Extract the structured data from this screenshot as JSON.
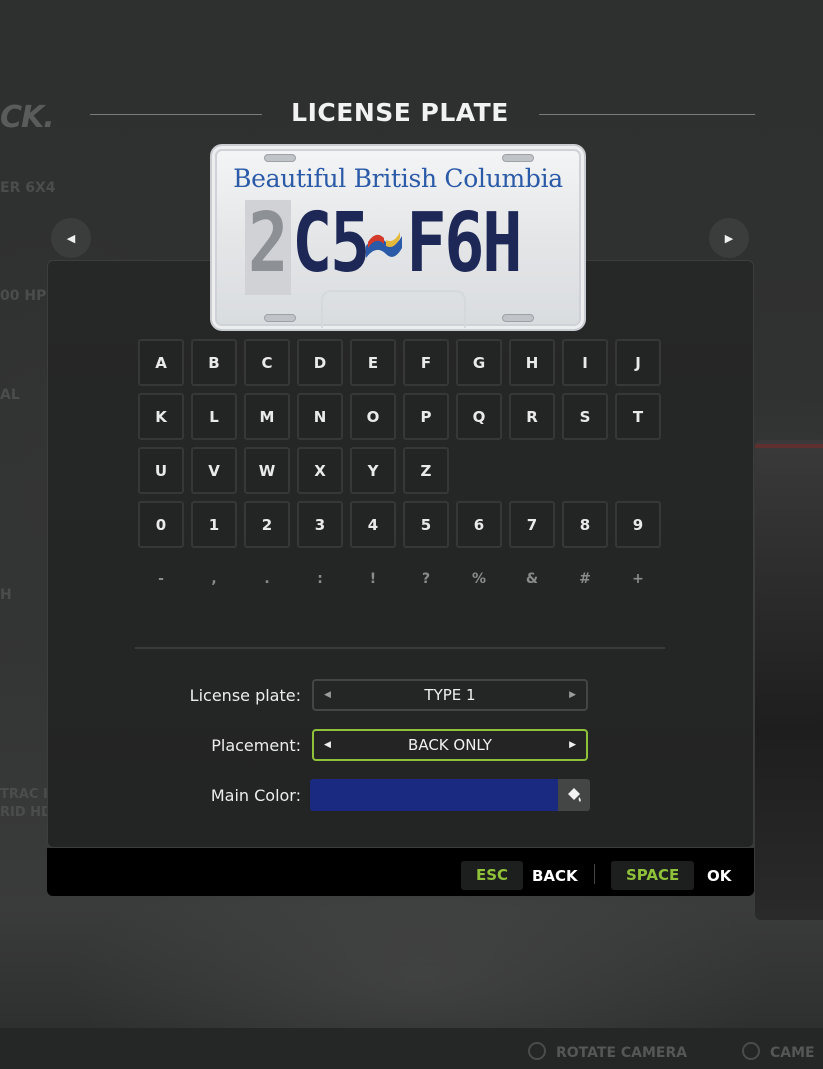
{
  "title": "LICENSE PLATE",
  "background": {
    "logo": "CK.",
    "spec_lines": [
      "ER 6X4",
      "00 HP",
      "AL",
      "H",
      "TRAC I",
      "RID HD"
    ],
    "hints": [
      {
        "icon": "camera-rotate-icon",
        "label": "ROTATE CAMERA"
      },
      {
        "icon": "camera-icon",
        "label": "CAME"
      }
    ]
  },
  "plate": {
    "slogan": "Beautiful British Columbia",
    "cursor_char": "2",
    "number": "C5 F6H",
    "text_color": "#1e2857"
  },
  "keyboard": {
    "rows": [
      [
        "A",
        "B",
        "C",
        "D",
        "E",
        "F",
        "G",
        "H",
        "I",
        "J"
      ],
      [
        "K",
        "L",
        "M",
        "N",
        "O",
        "P",
        "Q",
        "R",
        "S",
        "T"
      ],
      [
        "U",
        "V",
        "W",
        "X",
        "Y",
        "Z"
      ],
      [
        "0",
        "1",
        "2",
        "3",
        "4",
        "5",
        "6",
        "7",
        "8",
        "9"
      ]
    ],
    "symbols": [
      "-",
      ",",
      ".",
      ":",
      "!",
      "?",
      "%",
      "&",
      "#",
      "+"
    ]
  },
  "options": {
    "license_plate": {
      "label": "License plate:",
      "value": "TYPE 1"
    },
    "placement": {
      "label": "Placement:",
      "value": "BACK ONLY"
    },
    "main_color": {
      "label": "Main Color:",
      "color": "#1a2a80"
    }
  },
  "footer": {
    "esc_key": "ESC",
    "esc_label": "BACK",
    "space_key": "SPACE",
    "space_label": "OK"
  },
  "colors": {
    "accent": "#8fc13a",
    "panel": "#262727"
  }
}
